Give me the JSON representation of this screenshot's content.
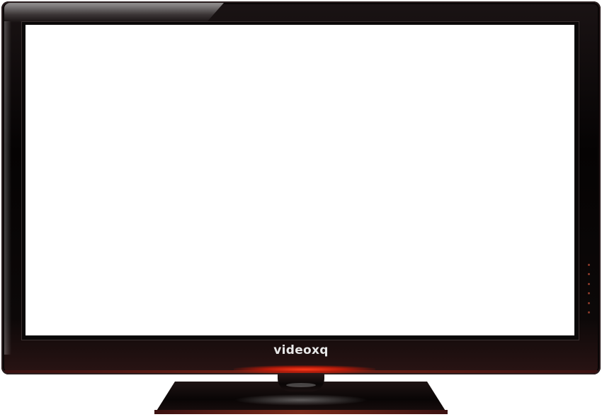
{
  "brand": {
    "name": "videoxq"
  },
  "colors": {
    "bezel": "#050303",
    "screen": "#ffffff",
    "accent_glow": "#ff3a1a",
    "brand_text": "#e8e8e8"
  },
  "icons": [
    "control-buttons"
  ]
}
